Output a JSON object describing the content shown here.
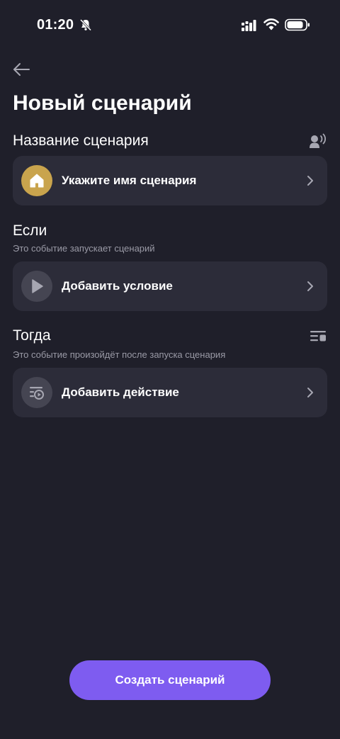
{
  "status_bar": {
    "time": "01:20",
    "icons": [
      "bell-off-icon",
      "signal-icon",
      "wifi-icon",
      "battery-icon"
    ]
  },
  "header": {
    "back_icon": "arrow-left-icon",
    "title": "Новый сценарий"
  },
  "name_section": {
    "title": "Название сценария",
    "side_icon": "voice-command-icon",
    "card": {
      "icon": "home-icon",
      "label": "Укажите имя сценария"
    }
  },
  "if_section": {
    "title": "Если",
    "subtitle": "Это событие запускает сценарий",
    "card": {
      "icon": "play-icon",
      "label": "Добавить условие"
    }
  },
  "then_section": {
    "title": "Тогда",
    "subtitle": "Это событие произойдёт после запуска сценария",
    "side_icon": "list-settings-icon",
    "card": {
      "icon": "action-icon",
      "label": "Добавить действие"
    }
  },
  "footer": {
    "create_label": "Создать сценарий"
  },
  "colors": {
    "background": "#1f1f2a",
    "card": "#2c2c39",
    "accent": "#7e5cf0",
    "home_badge": "#c9a44d",
    "muted_text": "#9a9aa6"
  }
}
